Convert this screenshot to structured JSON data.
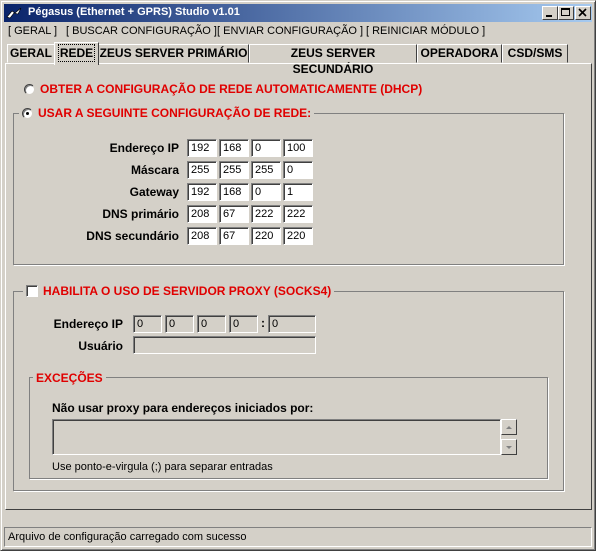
{
  "window": {
    "title": "Pégasus (Ethernet + GPRS) Studio v1.01"
  },
  "menu": [
    "[ GERAL ]",
    "[ BUSCAR CONFIGURAÇÃO ]",
    "[ ENVIAR CONFIGURAÇÃO ]",
    "[ REINICIAR MÓDULO ]"
  ],
  "tabs": [
    "GERAL",
    "REDE",
    "ZEUS SERVER PRIMÁRIO",
    "ZEUS SERVER SECUNDÁRIO",
    "OPERADORA",
    "CSD/SMS"
  ],
  "selected_tab": "REDE",
  "network": {
    "dhcp_label": "OBTER A CONFIGURAÇÃO DE REDE AUTOMATICAMENTE (DHCP)",
    "dhcp_selected": false,
    "manual_label": "USAR A SEGUINTE CONFIGURAÇÃO DE REDE:",
    "manual_selected": true,
    "fields": [
      {
        "label": "Endereço IP",
        "octets": [
          "192",
          "168",
          "0",
          "100"
        ]
      },
      {
        "label": "Máscara",
        "octets": [
          "255",
          "255",
          "255",
          "0"
        ]
      },
      {
        "label": "Gateway",
        "octets": [
          "192",
          "168",
          "0",
          "1"
        ]
      },
      {
        "label": "DNS primário",
        "octets": [
          "208",
          "67",
          "222",
          "222"
        ]
      },
      {
        "label": "DNS secundário",
        "octets": [
          "208",
          "67",
          "220",
          "220"
        ]
      }
    ]
  },
  "proxy": {
    "enable_label": "HABILITA O USO DE SERVIDOR PROXY (SOCKS4)",
    "enabled": false,
    "ip_label": "Endereço IP",
    "ip_octets": [
      "0",
      "0",
      "0",
      "0"
    ],
    "port_separator": ":",
    "port": "0",
    "user_label": "Usuário",
    "user_value": "",
    "exceptions": {
      "title": "EXCEÇÕES",
      "prompt": "Não usar proxy para endereços iniciados por:",
      "value": "",
      "hint": "Use ponto-e-virgula (;) para separar entradas"
    }
  },
  "status": "Arquivo de configuração carregado com sucesso",
  "colors": {
    "accent_label": "#e00000",
    "title_bar": "#0a246a",
    "face": "#d4d0c8"
  }
}
